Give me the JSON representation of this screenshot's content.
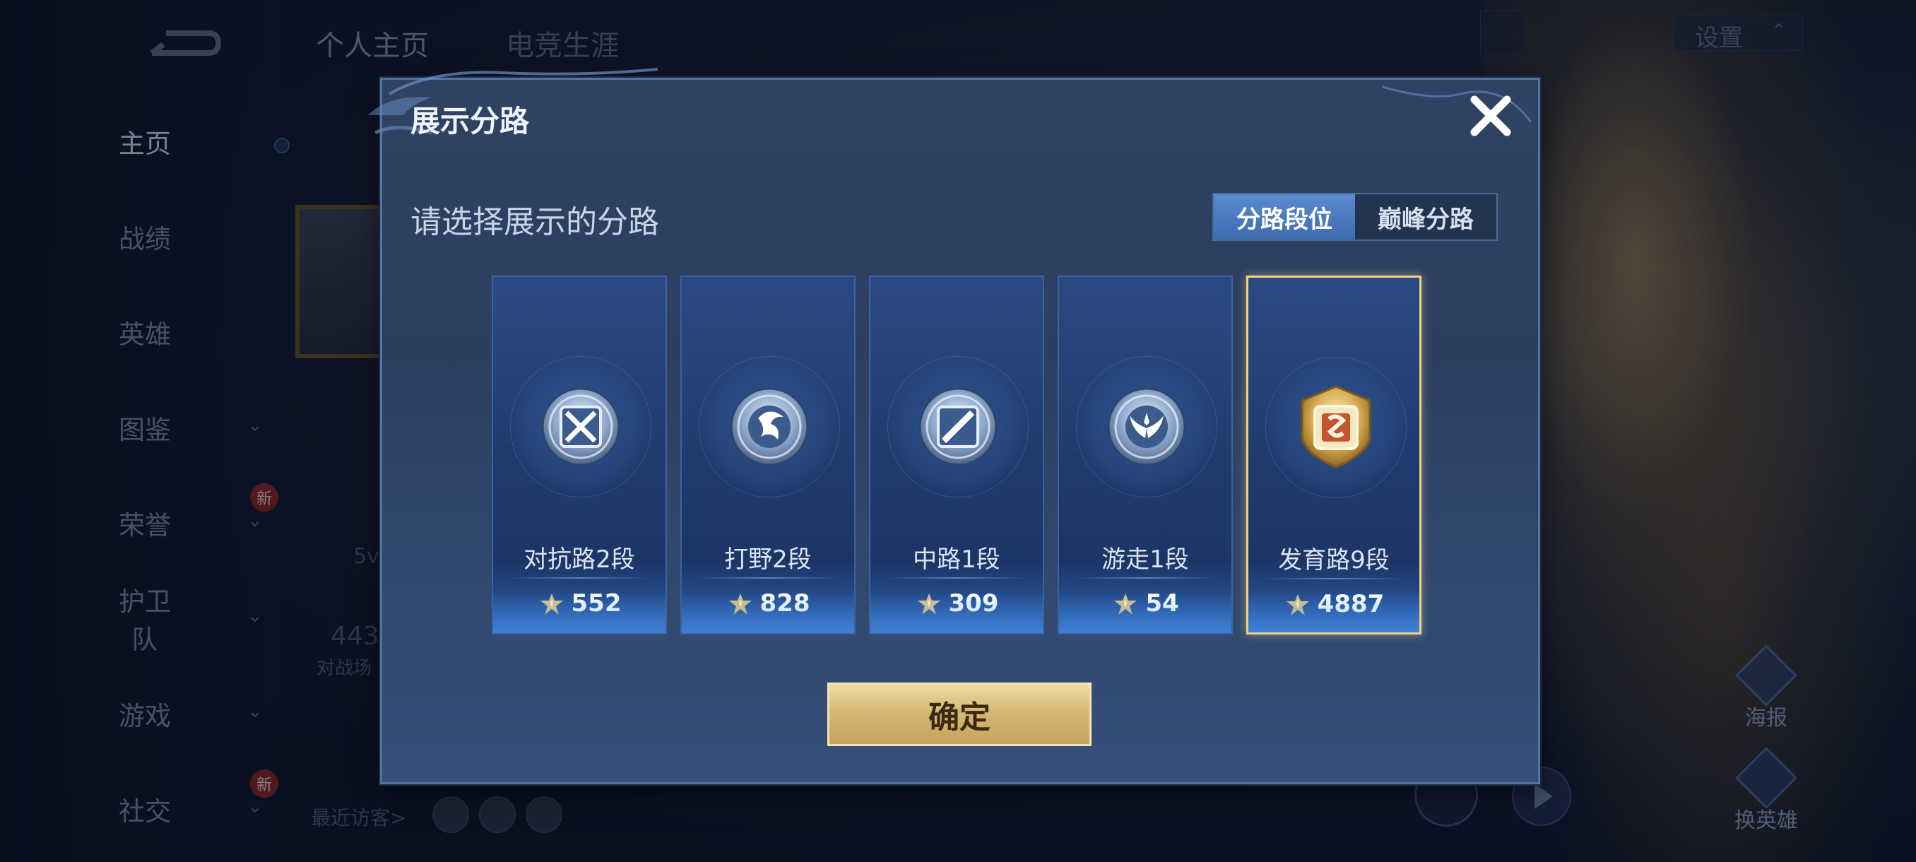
{
  "background": {
    "top_tabs": [
      "个人主页",
      "电竞生涯"
    ],
    "settings_label": "设置",
    "nav_items": [
      {
        "label": "主页",
        "active": true,
        "chevron": false,
        "new": false
      },
      {
        "label": "战绩",
        "active": false,
        "chevron": false,
        "new": false
      },
      {
        "label": "英雄",
        "active": false,
        "chevron": false,
        "new": false
      },
      {
        "label": "图鉴",
        "active": false,
        "chevron": true,
        "new": false
      },
      {
        "label": "荣誉",
        "active": false,
        "chevron": true,
        "new": true
      },
      {
        "label": "护卫队",
        "active": false,
        "chevron": true,
        "new": false
      },
      {
        "label": "游戏",
        "active": false,
        "chevron": true,
        "new": false
      },
      {
        "label": "社交",
        "active": false,
        "chevron": true,
        "new": true
      }
    ],
    "new_badge": "新",
    "recent_visitors_label": "最近访客>",
    "stat_number_partial": "443",
    "stat_label_partial": "对战场",
    "level_partial": "5v",
    "poster_label": "海报",
    "change_hero_label": "换英雄"
  },
  "modal": {
    "title": "展示分路",
    "subtitle": "请选择展示的分路",
    "toggle": {
      "option_a": "分路段位",
      "option_b": "巅峰分路",
      "selected": "option_a"
    },
    "lanes": [
      {
        "name": "对抗路2段",
        "score": "552",
        "emblem": "clash-lane-emblem-icon",
        "selected": false
      },
      {
        "name": "打野2段",
        "score": "828",
        "emblem": "jungle-dragon-emblem-icon",
        "selected": false
      },
      {
        "name": "中路1段",
        "score": "309",
        "emblem": "mid-lane-emblem-icon",
        "selected": false
      },
      {
        "name": "游走1段",
        "score": "54",
        "emblem": "roam-wings-emblem-icon",
        "selected": false
      },
      {
        "name": "发育路9段",
        "score": "4887",
        "emblem": "farm-lane-gold-emblem-icon",
        "selected": true
      }
    ],
    "confirm_label": "确定"
  },
  "colors": {
    "accent_gold": "#f1d287",
    "toggle_active": "#4a7bc4",
    "card_bg": "#1f3b6d"
  }
}
